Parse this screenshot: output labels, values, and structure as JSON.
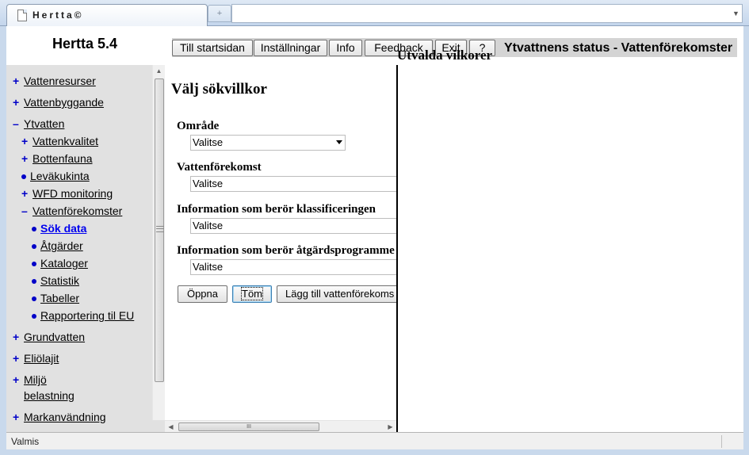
{
  "browser": {
    "tab_title": "Hertta©",
    "new_tab_glyph": "+"
  },
  "header": {
    "app_title": "Hertta 5.4",
    "page_heading": "Ytvattnens status - Vattenförekomster",
    "menu": {
      "start": "Till startsidan",
      "settings": "Inställningar",
      "info": "Info",
      "feedback": "Feedback",
      "exit": "Exit",
      "help": "?"
    }
  },
  "sidebar": {
    "items": [
      {
        "marker": "+",
        "label": "Vattenresurser"
      },
      {
        "marker": "+",
        "label": "Vattenbyggande"
      },
      {
        "marker": "–",
        "label": "Ytvatten"
      },
      {
        "marker": "+",
        "label": "Vattenkvalitet"
      },
      {
        "marker": "+",
        "label": "Bottenfauna"
      },
      {
        "marker": "•",
        "label": "Leväkukinta"
      },
      {
        "marker": "+",
        "label": "WFD monitoring"
      },
      {
        "marker": "–",
        "label": "Vattenförekomster"
      },
      {
        "marker": "•",
        "label": "Sök data"
      },
      {
        "marker": "•",
        "label": "Åtgärder"
      },
      {
        "marker": "•",
        "label": "Kataloger"
      },
      {
        "marker": "•",
        "label": "Statistik"
      },
      {
        "marker": "•",
        "label": "Tabeller"
      },
      {
        "marker": "•",
        "label": "Rapportering til EU"
      },
      {
        "marker": "+",
        "label": "Grundvatten"
      },
      {
        "marker": "+",
        "label": "Eliölajit"
      },
      {
        "marker": "+",
        "label": "Miljö"
      },
      {
        "marker": "",
        "label": "belastning"
      },
      {
        "marker": "+",
        "label": "Markanvändning"
      }
    ]
  },
  "form": {
    "title": "Välj sökvillkor",
    "fields": [
      {
        "label": "Område",
        "value": "Valitse"
      },
      {
        "label": "Vattenförekomst",
        "value": "Valitse"
      },
      {
        "label": "Information som berör klassificeringen",
        "value": "Valitse"
      },
      {
        "label": "Information som berör åtgärdsprogramme",
        "value": "Valitse"
      }
    ],
    "buttons": {
      "open": "Öppna",
      "clear": "Töm",
      "add": "Lägg till vattenförekoms"
    }
  },
  "scrollbar": {
    "grip": "III"
  },
  "selected": {
    "title": "Utvalda vilkorer"
  },
  "status": {
    "text": "Valmis"
  }
}
